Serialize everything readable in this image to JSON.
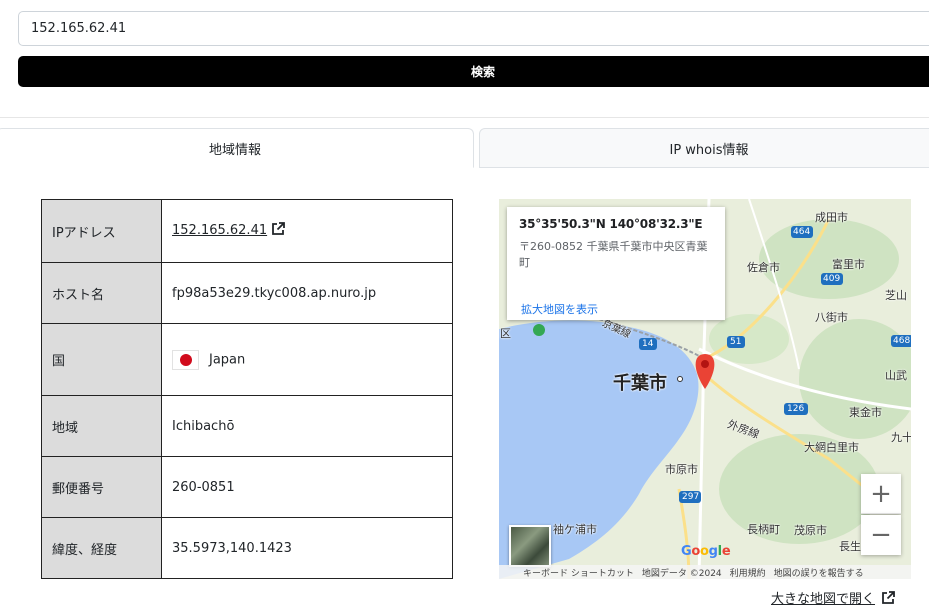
{
  "search": {
    "value": "152.165.62.41",
    "button_label": "検索"
  },
  "tabs": [
    {
      "label": "地域情報"
    },
    {
      "label": "IP whois情報"
    }
  ],
  "info_table": {
    "rows": [
      {
        "label": "IPアドレス",
        "value": "152.165.62.41"
      },
      {
        "label": "ホスト名",
        "value": "fp98a53e29.tkyc008.ap.nuro.jp"
      },
      {
        "label": "国",
        "value": "Japan"
      },
      {
        "label": "地域",
        "value": "Ichibachō"
      },
      {
        "label": "郵便番号",
        "value": "260-0851"
      },
      {
        "label": "緯度、経度",
        "value": "35.5973,140.1423"
      }
    ]
  },
  "map": {
    "card": {
      "coords": "35°35'50.3\"N 140°08'32.3\"E",
      "address": "〒260-0852 千葉県千葉市中央区青葉町",
      "enlarge_link": "拡大地図を表示"
    },
    "labels": {
      "chiba_city": "千葉市",
      "narita": "成田市",
      "sakura": "佐倉市",
      "tomisato": "富里市",
      "yachimata": "八街市",
      "shibayama": "芝山",
      "sammu": "山武",
      "togane": "東金市",
      "oamishirasato": "大網白里市",
      "kujukuri": "九十",
      "ichihara": "市原市",
      "nagara": "長柄町",
      "mobara": "茂原市",
      "chonan": "長生",
      "sodegaura": "袖ケ浦市",
      "sotobo_line": "外房線",
      "keiyo_line": "京葉線",
      "ku": "区",
      "road_464": "464",
      "road_409": "409",
      "road_51": "51",
      "road_14": "14",
      "road_126": "126",
      "road_297": "297",
      "road_468": "468"
    },
    "zoom_in": "+",
    "zoom_out": "−",
    "google": [
      "G",
      "o",
      "o",
      "g",
      "l",
      "e"
    ],
    "google_colors": [
      "#4285F4",
      "#EA4335",
      "#FBBC05",
      "#4285F4",
      "#34A853",
      "#EA4335"
    ],
    "attribution": [
      "キーボード ショートカット",
      "地図データ ©2024",
      "利用規約",
      "地図の誤りを報告する"
    ]
  },
  "big_map_link": "大きな地図で開く"
}
